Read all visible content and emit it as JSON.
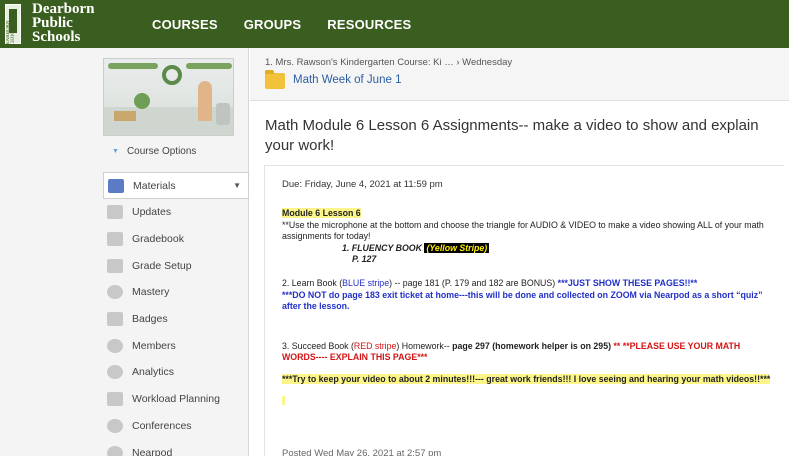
{
  "header": {
    "logo_line1": "Dearborn",
    "logo_line2": "Public",
    "logo_line3": "Schools",
    "logo_vertical": "DEARBORN SCHOOLS",
    "nav": [
      "COURSES",
      "GROUPS",
      "RESOURCES"
    ],
    "bg_color": "#3a5e1f"
  },
  "sidebar": {
    "course_options": "Course Options",
    "items": [
      {
        "label": "Materials",
        "icon": "materials-icon",
        "active": true
      },
      {
        "label": "Updates",
        "icon": "updates-icon"
      },
      {
        "label": "Gradebook",
        "icon": "gradebook-icon"
      },
      {
        "label": "Grade Setup",
        "icon": "grade-setup-icon"
      },
      {
        "label": "Mastery",
        "icon": "mastery-icon"
      },
      {
        "label": "Badges",
        "icon": "badges-icon"
      },
      {
        "label": "Members",
        "icon": "members-icon"
      },
      {
        "label": "Analytics",
        "icon": "analytics-icon"
      },
      {
        "label": "Workload Planning",
        "icon": "workload-planning-icon"
      },
      {
        "label": "Conferences",
        "icon": "conferences-icon"
      },
      {
        "label": "Nearpod",
        "icon": "nearpod-icon"
      }
    ]
  },
  "main": {
    "breadcrumb": "1. Mrs. Rawson's Kindergarten Course: Ki … › Wednesday",
    "folder_title": "Math Week of June 1",
    "page_title": "Math Module 6 Lesson 6 Assignments-- make a video to show and explain your work!",
    "due": "Due: Friday, June 4, 2021 at 11:59 pm",
    "content": {
      "heading": "Module 6  Lesson 6",
      "intro": "**Use the microphone at the bottom and choose the triangle for AUDIO & VIDEO to make a video showing ALL of your math assignments for today!",
      "fluency_label": "1.  FLUENCY BOOK",
      "fluency_stripe": "(Yellow Stripe)",
      "fluency_page": "P. 127",
      "learn_a": "2.  Learn Book (",
      "learn_stripe": "BLUE stripe",
      "learn_b": ") -- page 181 (P. 179 and 182 are BONUS)  ",
      "learn_c": "***JUST SHOW THESE PAGES!!**",
      "learn_d": "***DO NOT do page 183 exit ticket at home---this will be done and collected on ZOOM via Nearpod as a short “quiz” after the lesson.",
      "succeed_a": "3. Succeed Book (",
      "succeed_stripe": "RED stripe",
      "succeed_b": ") Homework-- ",
      "succeed_c": "page 297  (homework helper is on 295)",
      "succeed_d": " ** **PLEASE USE YOUR MATH WORDS----  EXPLAIN THIS PAGE***",
      "closing": "***Try to keep your video to about 2 minutes!!!--- great work friends!!!  I love seeing and hearing your math videos!!***"
    },
    "posted": "Posted Wed May 26, 2021 at 2:57 pm"
  }
}
